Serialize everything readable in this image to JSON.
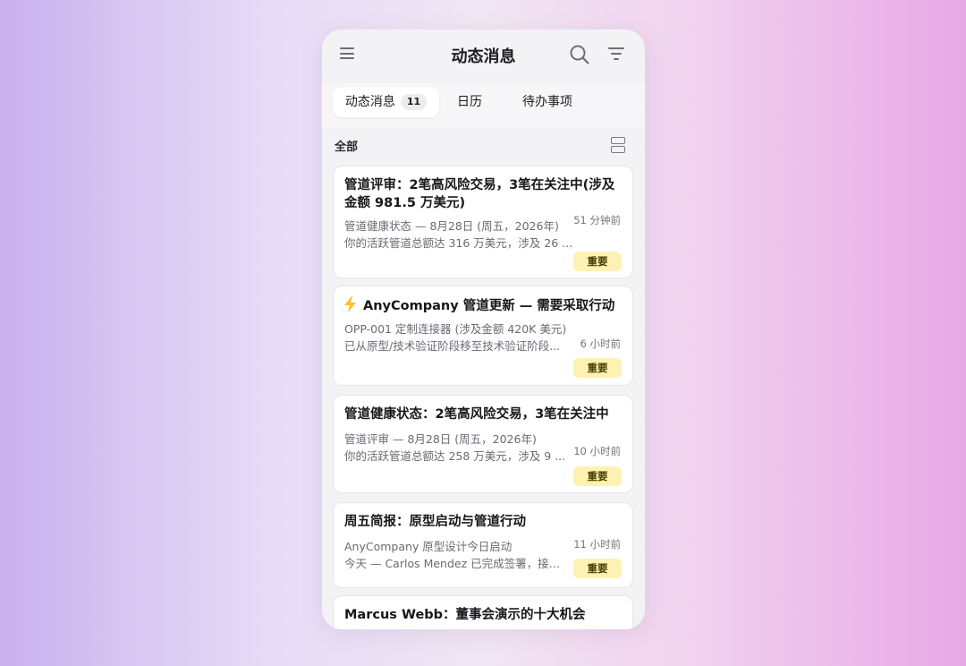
{
  "header": {
    "title": "动态消息",
    "icons": [
      "menu-icon",
      "search-icon",
      "filter-icon"
    ]
  },
  "tabs": [
    {
      "label": "动态消息",
      "badge": "11",
      "active": true
    },
    {
      "label": "日历"
    },
    {
      "label": "待办事项"
    }
  ],
  "section": {
    "label": "全部",
    "icon": "layout-toggle-icon"
  },
  "cards": [
    {
      "title": "管道评审：2笔高风险交易，3笔在关注中(涉及金额 981.5 万美元)",
      "line1": "管道健康状态 — 8月28日 (周五，2026年)",
      "line2": "你的活跃管道总额达 316 万美元，涉及 26 ...",
      "time": "51 分钟前",
      "badge": "重要"
    },
    {
      "icon": "lightning-bolt-icon",
      "title": "AnyCompany 管道更新 — 需要采取行动",
      "line1": "OPP-001 定制连接器 (涉及金额 420K 美元)",
      "line2": "已从原型/技术验证阶段移至技术验证阶段...",
      "time": "6 小时前",
      "badge": "重要"
    },
    {
      "title": "管道健康状态：2笔高风险交易，3笔在关注中",
      "line1": "管道评审 — 8月28日 (周五，2026年)",
      "line2": "你的活跃管道总额达 258 万美元，涉及 9 ...",
      "time": "10 小时前",
      "badge": "重要"
    },
    {
      "title": "周五简报：原型启动与管道行动",
      "line1": "AnyCompany 原型设计今日启动",
      "line2": "今天 — Carlos Mendez 已完成签署，接下...",
      "time": "11 小时前",
      "badge": "重要"
    },
    {
      "title": "Marcus Webb：董事会演示的十大机会"
    }
  ],
  "colors": {
    "badge_bg": "#fdf2b3",
    "bolt": "#f7c22b",
    "card_bg": "#ffffff",
    "panel_bg": "#f3f3f6"
  }
}
